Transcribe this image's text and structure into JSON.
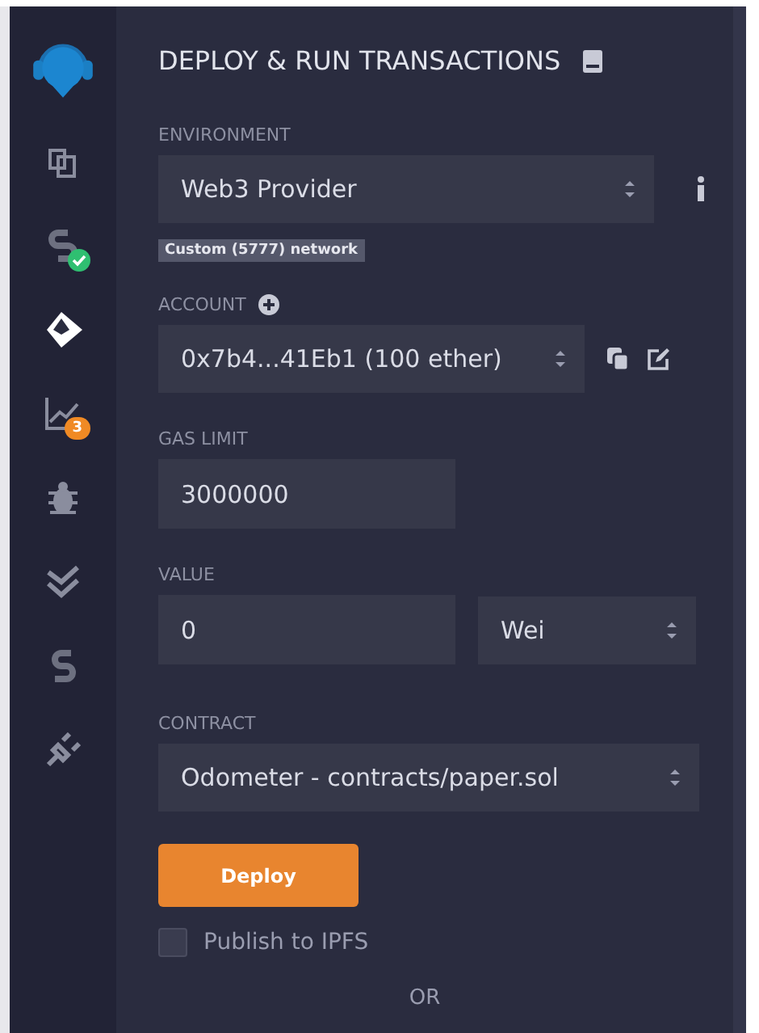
{
  "sidebar": {
    "items": [
      {
        "kind": "logo"
      },
      {
        "kind": "files",
        "selected": false
      },
      {
        "kind": "compiler",
        "selected": false,
        "badge": {
          "kind": "check"
        }
      },
      {
        "kind": "deploy",
        "selected": true
      },
      {
        "kind": "analysis",
        "selected": false,
        "badge": {
          "kind": "count",
          "text": "3"
        }
      },
      {
        "kind": "debugger",
        "selected": false
      },
      {
        "kind": "tests",
        "selected": false
      },
      {
        "kind": "plugin-s",
        "selected": false
      },
      {
        "kind": "plugin-manager",
        "selected": false
      }
    ]
  },
  "panel": {
    "title": "DEPLOY & RUN TRANSACTIONS",
    "environment": {
      "label": "ENVIRONMENT",
      "value": "Web3 Provider",
      "network": "Custom (5777) network"
    },
    "account": {
      "label": "ACCOUNT",
      "value": "0x7b4...41Eb1 (100 ether)"
    },
    "gas_limit": {
      "label": "GAS LIMIT",
      "value": "3000000"
    },
    "value": {
      "label": "VALUE",
      "amount": "0",
      "unit": "Wei"
    },
    "contract": {
      "label": "CONTRACT",
      "value": "Odometer - contracts/paper.sol"
    },
    "deploy_button": "Deploy",
    "publish": {
      "label": "Publish to IPFS",
      "checked": false
    },
    "or": "OR"
  }
}
